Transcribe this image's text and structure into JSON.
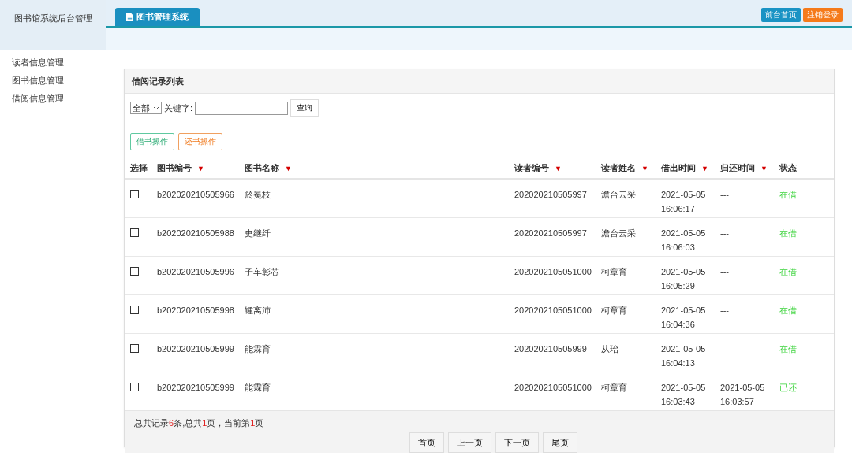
{
  "brand": "图书馆系统后台管理",
  "tabs": [
    {
      "label": "图书管理系统",
      "selected": true
    }
  ],
  "header_buttons": [
    {
      "label": "前台首页",
      "kind": "primary"
    },
    {
      "label": "注销登录",
      "kind": "warning"
    }
  ],
  "sidebar": {
    "items": [
      {
        "label": "读者信息管理"
      },
      {
        "label": "图书信息管理"
      },
      {
        "label": "借阅信息管理"
      }
    ]
  },
  "panel": {
    "title": "借阅记录列表",
    "filter": {
      "select": "全部",
      "keyword_label": "关键字:",
      "search_button": "查询"
    },
    "actions": [
      {
        "label": "借书操作",
        "kind": "borrow"
      },
      {
        "label": "还书操作",
        "kind": "return"
      }
    ],
    "table": {
      "select_header": "选择",
      "columns": [
        {
          "label": "图书编号",
          "sort_mark": "▼"
        },
        {
          "label": "图书名称",
          "sort_mark": "▼"
        },
        {
          "label": "读者编号",
          "sort_mark": "▼"
        },
        {
          "label": "读者姓名",
          "sort_mark": "▼"
        },
        {
          "label": "借出时间",
          "sort_mark": "▼"
        },
        {
          "label": "归还时间",
          "sort_mark": "▼"
        },
        {
          "label": "状态"
        }
      ],
      "rows": [
        {
          "checked": false,
          "cells": [
            "b202020210505966",
            "於冕枝",
            "202020210505997",
            "澹台云采",
            "2021-05-05 16:06:17",
            "---",
            "在借"
          ]
        },
        {
          "checked": false,
          "cells": [
            "b202020210505988",
            "史继纤",
            "202020210505997",
            "澹台云采",
            "2021-05-05 16:06:03",
            "---",
            "在借"
          ]
        },
        {
          "checked": false,
          "cells": [
            "b202020210505996",
            "子车彰芯",
            "2020202105051000",
            "柯章育",
            "2021-05-05 16:05:29",
            "---",
            "在借"
          ]
        },
        {
          "checked": false,
          "cells": [
            "b202020210505998",
            "锺离沛",
            "2020202105051000",
            "柯章育",
            "2021-05-05 16:04:36",
            "---",
            "在借"
          ]
        },
        {
          "checked": false,
          "cells": [
            "b202020210505999",
            "能霖育",
            "202020210505999",
            "从珆",
            "2021-05-05 16:04:13",
            "---",
            "在借"
          ]
        },
        {
          "checked": false,
          "cells": [
            "b202020210505999",
            "能霖育",
            "2020202105051000",
            "柯章育",
            "2021-05-05 16:03:43",
            "2021-05-05 16:03:57",
            "已还"
          ]
        }
      ]
    },
    "summary": [
      {
        "text": "总共记录",
        "highlight": false
      },
      {
        "text": "6",
        "highlight": true
      },
      {
        "text": "条,总共",
        "highlight": false
      },
      {
        "text": "1",
        "highlight": true
      },
      {
        "text": "页，当前第",
        "highlight": false
      },
      {
        "text": "1",
        "highlight": true
      },
      {
        "text": "页",
        "highlight": false
      }
    ],
    "pagination": [
      "首页",
      "上一页",
      "下一页",
      "尾页"
    ]
  }
}
